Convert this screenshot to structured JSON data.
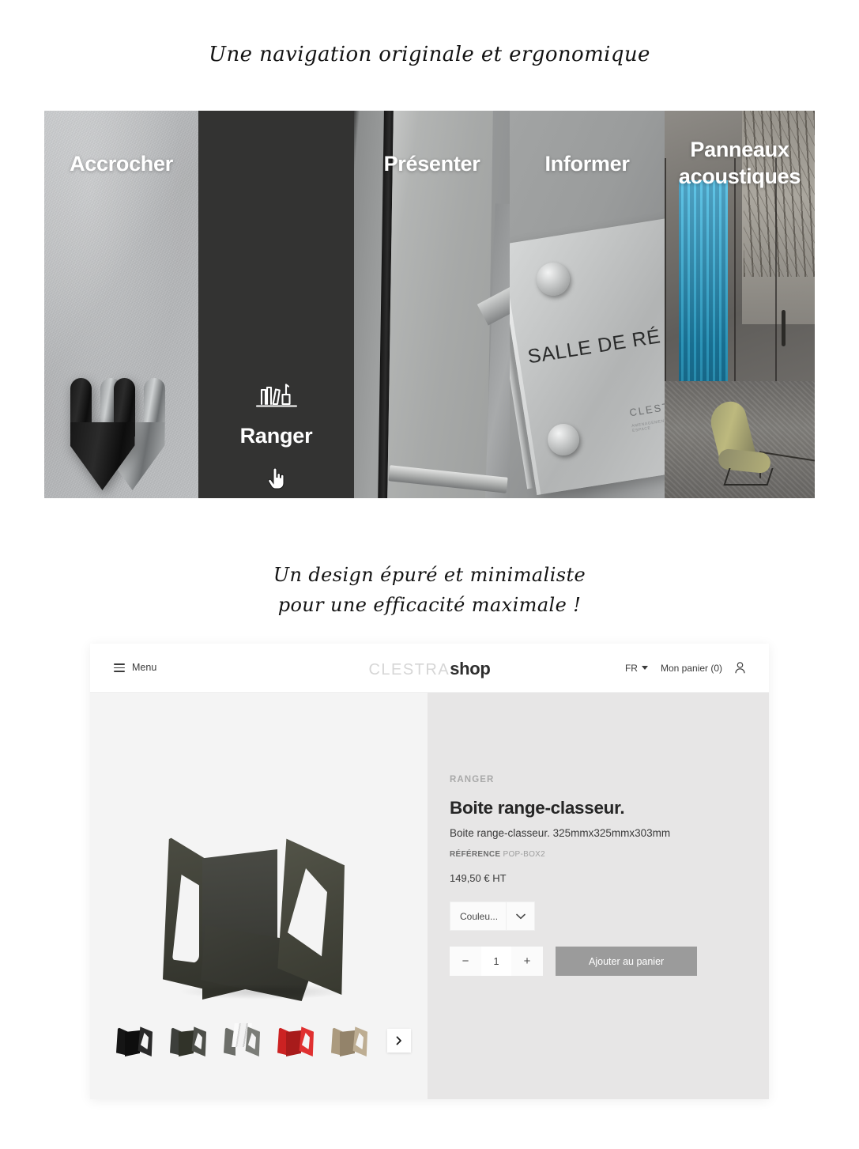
{
  "headings": {
    "top": "Une navigation originale et ergonomique",
    "bottom_line1": "Un design épuré et minimaliste",
    "bottom_line2": "pour une efficacité maximale !"
  },
  "nav": {
    "panels": [
      {
        "label": "Accrocher",
        "active": false,
        "image": "wall-hook-photo"
      },
      {
        "label": "Ranger",
        "active": true,
        "icon": "bookshelf-icon"
      },
      {
        "label": "Présenter",
        "active": false,
        "image": "whiteboard-photo"
      },
      {
        "label": "Informer",
        "active": false,
        "image": "glass-sign-photo"
      },
      {
        "label": "Panneaux acoustiques",
        "active": false,
        "image": "office-acoustic-panels-photo"
      }
    ],
    "sign_text": "SALLE DE RÉ",
    "sign_brand": "CLESTRA",
    "sign_sub": "AMENAGEMENT INTERIEUR / ESPACE"
  },
  "shop": {
    "header": {
      "menu_label": "Menu",
      "logo_part1": "CLESTRA",
      "logo_part2": "shop",
      "language": "FR",
      "cart_label": "Mon panier (0)"
    },
    "product": {
      "category": "RANGER",
      "title": "Boite range-classeur.",
      "description": "Boite range-classeur. 325mmx325mmx303mm",
      "reference_label": "RÉFÉRENCE",
      "reference_value": "POP-BOX2",
      "price": "149,50 € HT",
      "color_select": "Couleu...",
      "quantity": "1",
      "minus": "−",
      "plus": "+",
      "add_to_cart": "Ajouter au panier"
    },
    "thumbnails": [
      {
        "name": "black",
        "color": "#151515",
        "color2": "#2a2a2a",
        "color3": "#0e0e0e",
        "files": false
      },
      {
        "name": "dark-grey",
        "color": "#3d3f3b",
        "color2": "#4d4f49",
        "color3": "#313329",
        "files": false
      },
      {
        "name": "grey-with-files",
        "color": "#6c6e69",
        "color2": "#7b7d78",
        "color3": "#5d5f5a",
        "files": true
      },
      {
        "name": "red",
        "color": "#cc2222",
        "color2": "#e03030",
        "color3": "#a81b1b",
        "files": false
      },
      {
        "name": "beige",
        "color": "#ab9a7e",
        "color2": "#bdad92",
        "color3": "#93836a",
        "files": false
      }
    ],
    "next_arrow": "chevron-right-icon"
  },
  "colors": {
    "panel_active_bg": "#333332",
    "card_bg": "#ffffff",
    "gallery_bg": "#f4f4f4",
    "detail_bg": "#e7e6e6",
    "cta_bg": "#9b9b9b",
    "page_bg": "#ffffff"
  }
}
